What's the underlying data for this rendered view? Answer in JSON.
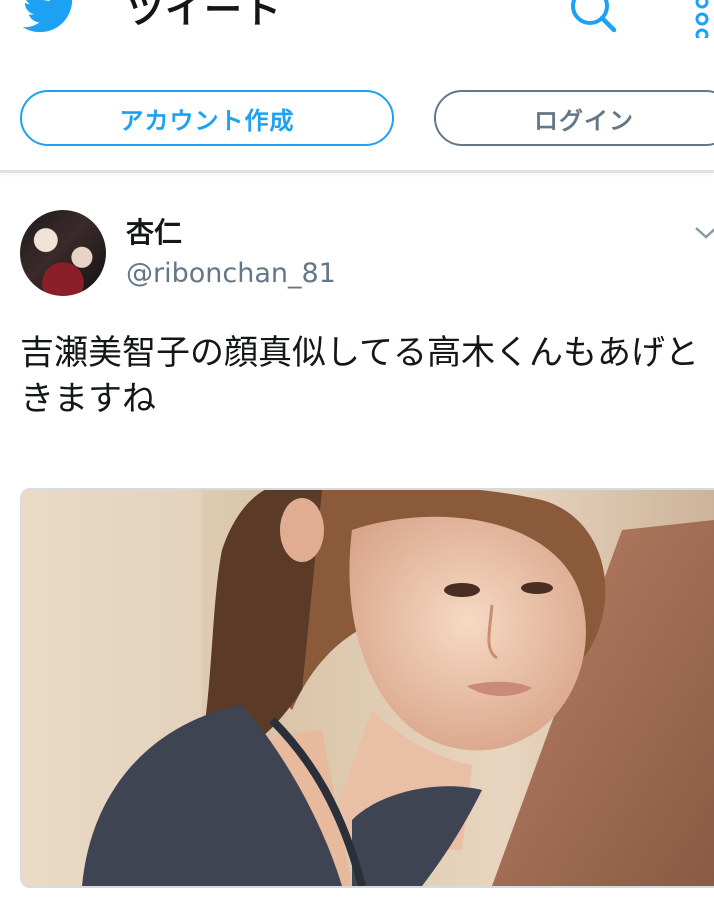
{
  "header": {
    "title": "ツイート",
    "logo_icon": "twitter-bird-icon",
    "search_icon": "search-icon",
    "more_icon": "more-vertical-icon",
    "brand_color": "#1da1f2"
  },
  "auth": {
    "signup_label": "アカウント作成",
    "login_label": "ログイン"
  },
  "tweet": {
    "display_name": "杏仁",
    "handle": "@ribonchan_81",
    "text": "吉瀬美智子の顔真似してる高木くんもあげときますね",
    "menu_icon": "chevron-down-icon"
  }
}
